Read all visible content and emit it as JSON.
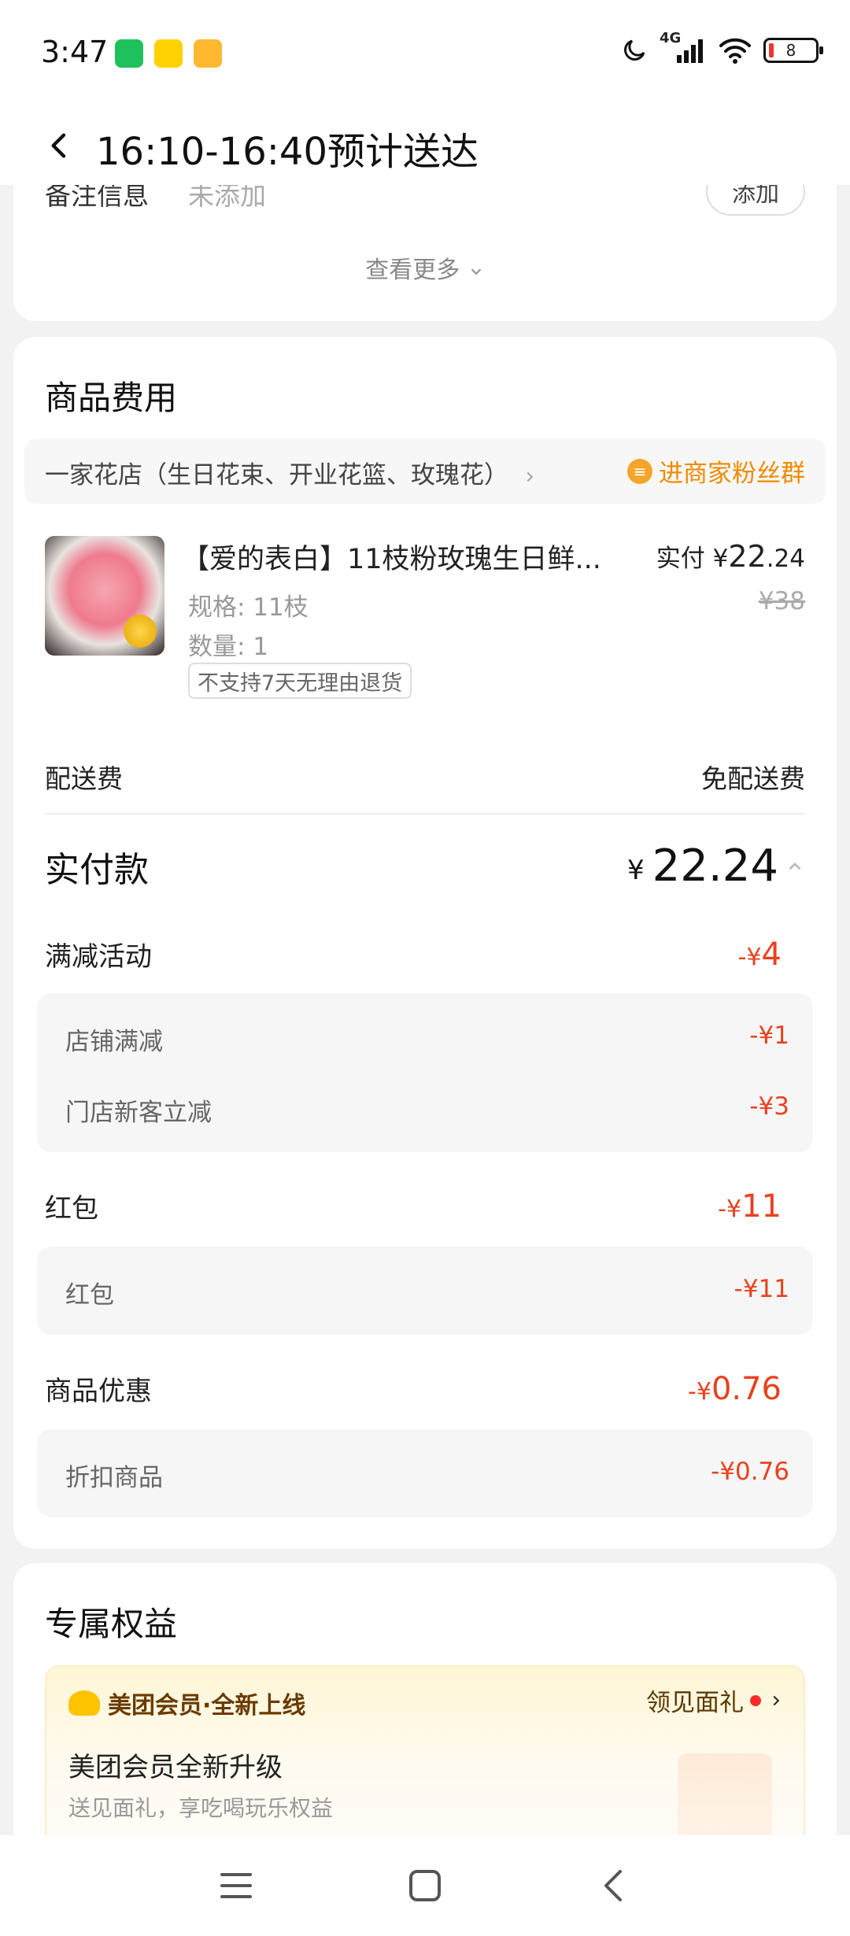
{
  "status_bar": {
    "time": "3:47",
    "app_icons": [
      "wechat-icon",
      "meituan-icon",
      "notes-icon"
    ],
    "network": "4G",
    "battery": "8"
  },
  "header": {
    "title": "16:10-16:40预计送达"
  },
  "remark": {
    "label": "备注信息",
    "value": "未添加",
    "add_label": "添加",
    "more_label": "查看更多"
  },
  "fees": {
    "title": "商品费用",
    "store_name": "一家花店（生日花束、开业花篮、玫瑰花）",
    "fans_group": "进商家粉丝群",
    "item": {
      "name": "【爱的表白】11枝粉玫瑰生日鲜...",
      "spec": "规格: 11枝",
      "qty": "数量: 1",
      "refund_note": "不支持7天无理由退货",
      "paid_label": "实付",
      "paid_currency": "¥",
      "paid_int": "22",
      "paid_dec": ".24",
      "original": "¥38"
    },
    "delivery_label": "配送费",
    "delivery_value": "免配送费",
    "total_label": "实付款",
    "total_currency": "¥",
    "total_value": "22.24",
    "discount_group": {
      "label": "满减活动",
      "prefix": "-¥",
      "value": "4",
      "items": [
        {
          "label": "店铺满减",
          "value": "-¥1"
        },
        {
          "label": "门店新客立减",
          "value": "-¥3"
        }
      ]
    },
    "redpacket_group": {
      "label": "红包",
      "prefix": "-¥",
      "value": "11",
      "items": [
        {
          "label": "红包",
          "value": "-¥11"
        }
      ]
    },
    "product_discount": {
      "label": "商品优惠",
      "prefix": "-¥",
      "value": "0.76",
      "items": [
        {
          "label": "折扣商品",
          "value": "-¥0.76"
        }
      ]
    }
  },
  "benefits": {
    "title": "专属权益",
    "brand": "美团会员·全新上线",
    "gift_label": "领见面礼",
    "member_title": "美团会员全新升级",
    "member_sub": "送见面礼，享吃喝玩乐权益"
  },
  "colors": {
    "accent_red": "#e8411f",
    "accent_orange": "#f08a00",
    "member_yellow": "#ffc300"
  }
}
